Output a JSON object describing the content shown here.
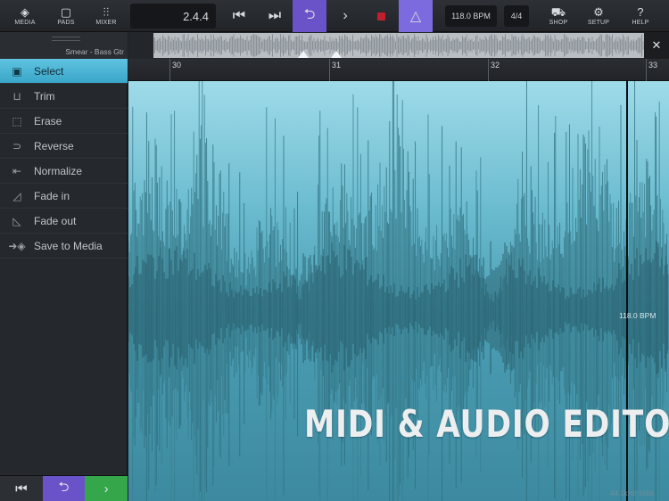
{
  "toolbar": {
    "media_label": "MEDIA",
    "pads_label": "PADS",
    "mixer_label": "MIXER",
    "position": "2.4.4",
    "tempo": "118.0 BPM",
    "time_signature": "4/4",
    "shop_label": "SHOP",
    "setup_label": "SETUP",
    "help_label": "HELP"
  },
  "track": {
    "name": "Smear - Bass Gtr"
  },
  "tools": [
    {
      "label": "Select",
      "icon": "select-box-icon"
    },
    {
      "label": "Trim",
      "icon": "trim-icon"
    },
    {
      "label": "Erase",
      "icon": "eraser-icon"
    },
    {
      "label": "Reverse",
      "icon": "reverse-icon"
    },
    {
      "label": "Normalize",
      "icon": "normalize-icon"
    },
    {
      "label": "Fade in",
      "icon": "fade-in-icon"
    },
    {
      "label": "Fade out",
      "icon": "fade-out-icon"
    },
    {
      "label": "Save to Media",
      "icon": "save-to-media-icon"
    }
  ],
  "ruler": {
    "bars": [
      "30",
      "31",
      "32",
      "33"
    ]
  },
  "editor": {
    "tempo_marker": "118.0 BPM",
    "promo_text": "MIDI & AUDIO EDITOR",
    "footer_tag": "44.1kHz  16bit"
  },
  "colors": {
    "accent_purple": "#6a52c9",
    "accent_cyan": "#4fb6d6",
    "accent_green": "#36a64a",
    "record_red": "#c0202e"
  }
}
